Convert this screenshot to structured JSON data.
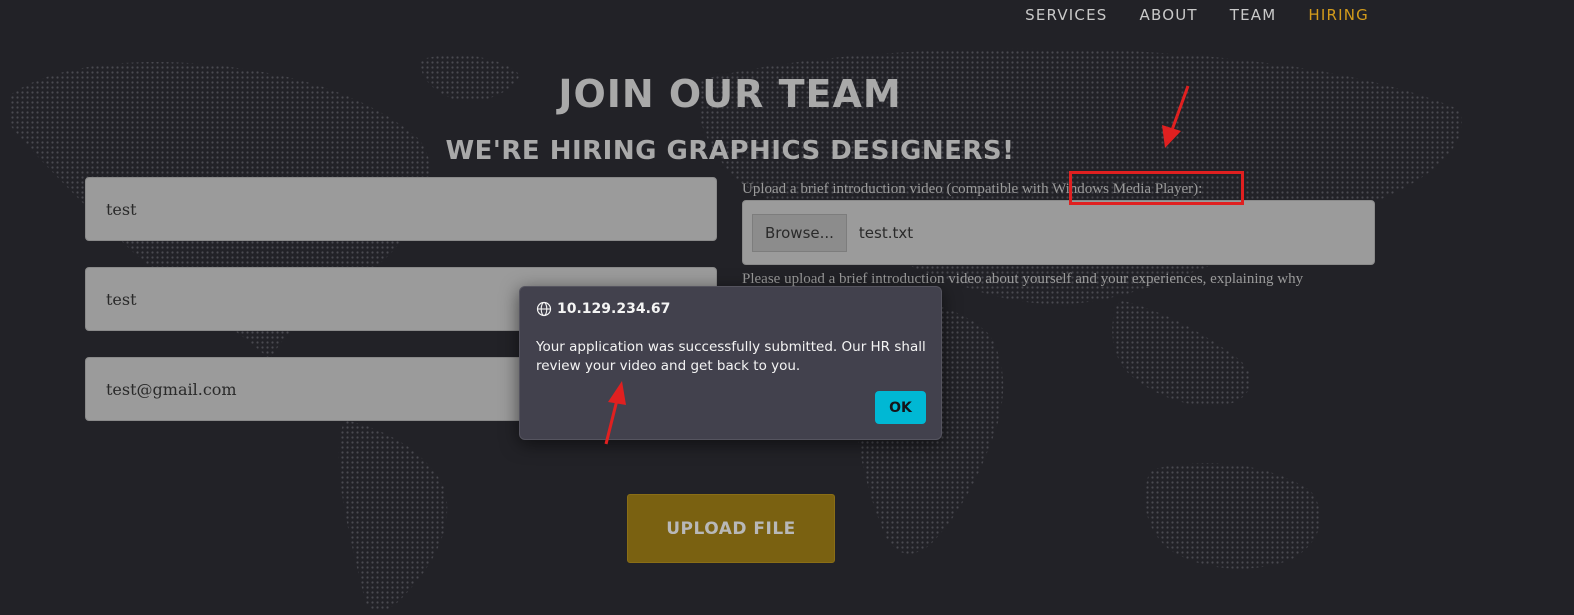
{
  "nav": {
    "items": [
      {
        "label": "SERVICES"
      },
      {
        "label": "ABOUT"
      },
      {
        "label": "TEAM"
      },
      {
        "label": "HIRING",
        "active": true
      }
    ],
    "active_color": "#d39b1b"
  },
  "hero": {
    "title": "JOIN OUR TEAM",
    "subtitle": "WE'RE HIRING GRAPHICS DESIGNERS!"
  },
  "form": {
    "field1_value": "test",
    "field2_value": "test",
    "email_value": "test@gmail.com",
    "upload_label": "Upload a brief introduction video (compatible with Windows Media Player):",
    "browse_label": "Browse...",
    "file_name": "test.txt",
    "upload_help": "Please upload a brief introduction video about yourself and your experiences, explaining why",
    "submit_label": "UPLOAD FILE"
  },
  "dialog": {
    "origin": "10.129.234.67",
    "message": "Your application was successfully submitted. Our HR shall review your video and get back to you.",
    "ok_label": "OK",
    "ok_color": "#00b8d4"
  },
  "annotation_color": "#e02020"
}
